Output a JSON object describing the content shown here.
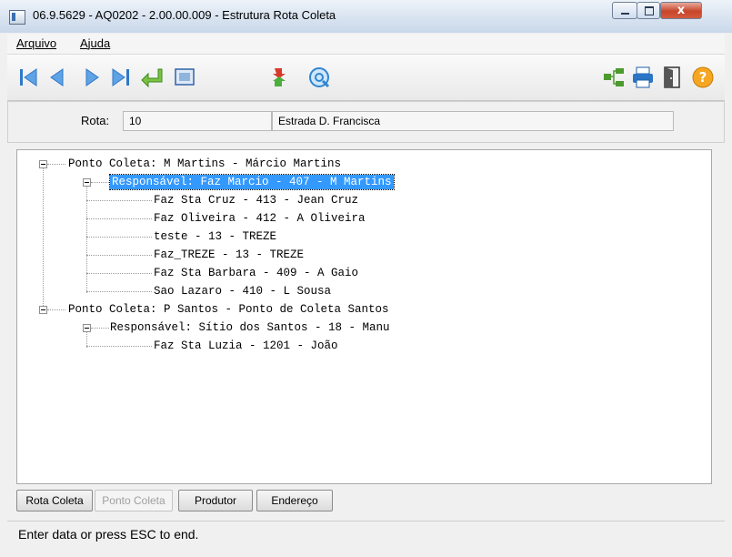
{
  "window": {
    "title": "06.9.5629 - AQ0202 - 2.00.00.009 - Estrutura Rota Coleta",
    "close_label": "x"
  },
  "menu": [
    "Arquivo",
    "Ajuda"
  ],
  "toolbar": {
    "left_icons": [
      "first-record-icon",
      "previous-record-icon",
      "next-record-icon",
      "last-record-icon",
      "enter-icon",
      "preview-icon"
    ],
    "middle_icons": [
      "refresh-icon",
      "search-icon"
    ],
    "right_icons": [
      "tree-structure-icon",
      "print-icon",
      "exit-door-icon",
      "help-icon"
    ]
  },
  "rota": {
    "label": "Rota:",
    "value": "10",
    "description": "Estrada D. Francisca"
  },
  "tree": {
    "nodes": [
      "Ponto Coleta: M Martins - Márcio Martins",
      "Responsável: Faz Marcio - 407 - M Martins",
      "Faz Sta Cruz - 413 - Jean Cruz",
      "Faz Oliveira - 412 - A Oliveira",
      "teste - 13 - TREZE",
      "Faz_TREZE - 13 - TREZE",
      "Faz Sta Barbara - 409 - A Gaio",
      "Sao Lazaro - 410 - L Sousa",
      "Ponto Coleta: P Santos - Ponto de Coleta Santos",
      "Responsável: Sítio dos Santos - 18 - Manu",
      "Faz Sta Luzia - 1201 - João"
    ],
    "selected_index": 1
  },
  "buttons": {
    "rota_coleta": "Rota Coleta",
    "ponto_coleta": "Ponto Coleta",
    "produtor": "Produtor",
    "endereco": "Endereço"
  },
  "status": "Enter data or press ESC to end.",
  "colors": {
    "selection": "#3399ff",
    "title_bar": "#dce6f2",
    "close_button": "#c7452b"
  }
}
